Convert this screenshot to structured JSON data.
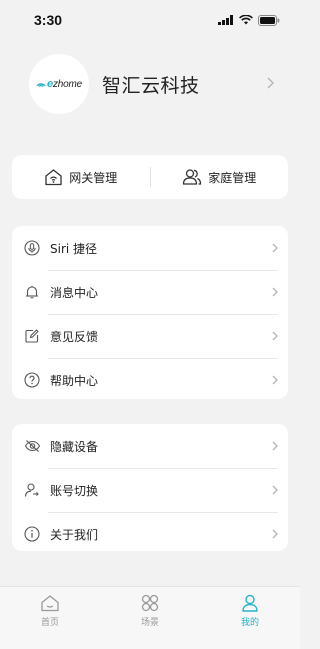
{
  "status_bar": {
    "time": "3:30"
  },
  "profile": {
    "avatar_logo_e": "e",
    "avatar_logo_rest": "zhome",
    "name": "智汇云科技"
  },
  "quick_actions": [
    {
      "label": "网关管理",
      "icon": "gateway-house-icon"
    },
    {
      "label": "家庭管理",
      "icon": "family-users-icon"
    }
  ],
  "menu_group_1": [
    {
      "label": "Siri 捷径",
      "icon": "microphone-icon"
    },
    {
      "label": "消息中心",
      "icon": "bell-icon"
    },
    {
      "label": "意见反馈",
      "icon": "edit-icon"
    },
    {
      "label": "帮助中心",
      "icon": "help-circle-icon"
    }
  ],
  "menu_group_2": [
    {
      "label": "隐藏设备",
      "icon": "eye-hidden-icon"
    },
    {
      "label": "账号切换",
      "icon": "user-switch-icon"
    },
    {
      "label": "关于我们",
      "icon": "info-circle-icon"
    }
  ],
  "tabbar": {
    "tabs": [
      {
        "label": "首页",
        "icon": "home-icon",
        "active": false
      },
      {
        "label": "场景",
        "icon": "scene-icon",
        "active": false
      },
      {
        "label": "我的",
        "icon": "profile-icon",
        "active": true
      }
    ]
  },
  "colors": {
    "accent": "#2bb4c9",
    "background": "#f2f2f2",
    "card": "#ffffff"
  }
}
